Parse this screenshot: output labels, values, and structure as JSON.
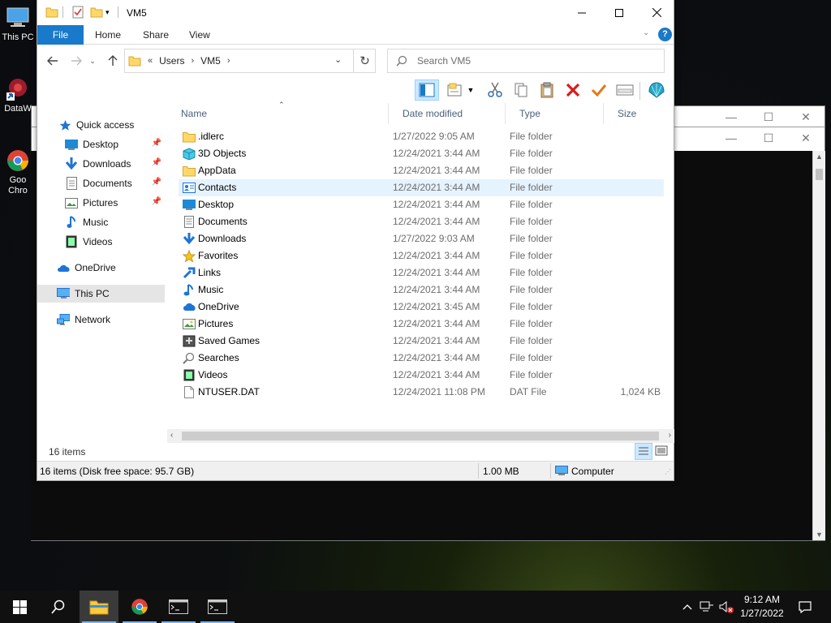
{
  "desktop": {
    "icons": [
      {
        "label": "This PC",
        "icon": "computer-icon"
      },
      {
        "label": "DataW",
        "icon": "app-icon"
      },
      {
        "label": "Goo Chro",
        "icon": "chrome-icon"
      }
    ]
  },
  "explorer": {
    "title": "VM5",
    "ribbon_tabs": [
      "File",
      "Home",
      "Share",
      "View"
    ],
    "address": {
      "prefix": "«",
      "segments": [
        "Users",
        "VM5"
      ]
    },
    "search_placeholder": "Search VM5",
    "nav": {
      "quick_access": "Quick access",
      "pinned": [
        "Desktop",
        "Downloads",
        "Documents",
        "Pictures"
      ],
      "unpinned": [
        "Music",
        "Videos"
      ],
      "onedrive": "OneDrive",
      "this_pc": "This PC",
      "network": "Network"
    },
    "columns": {
      "name": "Name",
      "date": "Date modified",
      "type": "Type",
      "size": "Size"
    },
    "files": [
      {
        "name": ".idlerc",
        "date": "1/27/2022 9:05 AM",
        "type": "File folder",
        "size": "",
        "icon": "folder-icon"
      },
      {
        "name": "3D Objects",
        "date": "12/24/2021 3:44 AM",
        "type": "File folder",
        "size": "",
        "icon": "3d-objects-icon"
      },
      {
        "name": "AppData",
        "date": "12/24/2021 3:44 AM",
        "type": "File folder",
        "size": "",
        "icon": "folder-icon"
      },
      {
        "name": "Contacts",
        "date": "12/24/2021 3:44 AM",
        "type": "File folder",
        "size": "",
        "icon": "contacts-icon"
      },
      {
        "name": "Desktop",
        "date": "12/24/2021 3:44 AM",
        "type": "File folder",
        "size": "",
        "icon": "desktop-icon"
      },
      {
        "name": "Documents",
        "date": "12/24/2021 3:44 AM",
        "type": "File folder",
        "size": "",
        "icon": "documents-icon"
      },
      {
        "name": "Downloads",
        "date": "1/27/2022 9:03 AM",
        "type": "File folder",
        "size": "",
        "icon": "downloads-icon"
      },
      {
        "name": "Favorites",
        "date": "12/24/2021 3:44 AM",
        "type": "File folder",
        "size": "",
        "icon": "star-icon"
      },
      {
        "name": "Links",
        "date": "12/24/2021 3:44 AM",
        "type": "File folder",
        "size": "",
        "icon": "links-icon"
      },
      {
        "name": "Music",
        "date": "12/24/2021 3:44 AM",
        "type": "File folder",
        "size": "",
        "icon": "music-icon"
      },
      {
        "name": "OneDrive",
        "date": "12/24/2021 3:45 AM",
        "type": "File folder",
        "size": "",
        "icon": "cloud-icon"
      },
      {
        "name": "Pictures",
        "date": "12/24/2021 3:44 AM",
        "type": "File folder",
        "size": "",
        "icon": "pictures-icon"
      },
      {
        "name": "Saved Games",
        "date": "12/24/2021 3:44 AM",
        "type": "File folder",
        "size": "",
        "icon": "saved-games-icon"
      },
      {
        "name": "Searches",
        "date": "12/24/2021 3:44 AM",
        "type": "File folder",
        "size": "",
        "icon": "search-icon"
      },
      {
        "name": "Videos",
        "date": "12/24/2021 3:44 AM",
        "type": "File folder",
        "size": "",
        "icon": "videos-icon"
      },
      {
        "name": "NTUSER.DAT",
        "date": "12/24/2021 11:08 PM",
        "type": "DAT File",
        "size": "1,024 KB",
        "icon": "file-icon"
      }
    ],
    "highlighted_row": 3,
    "item_count": "16 items",
    "status": {
      "disk": "16 items (Disk free space: 95.7 GB)",
      "size": "1.00 MB",
      "location": "Computer"
    }
  },
  "taskbar": {
    "clock_time": "9:12 AM",
    "clock_date": "1/27/2022"
  },
  "colors": {
    "accent": "#1979ca",
    "folder": "#ffd866",
    "row_highlight": "#e5f3ff"
  }
}
